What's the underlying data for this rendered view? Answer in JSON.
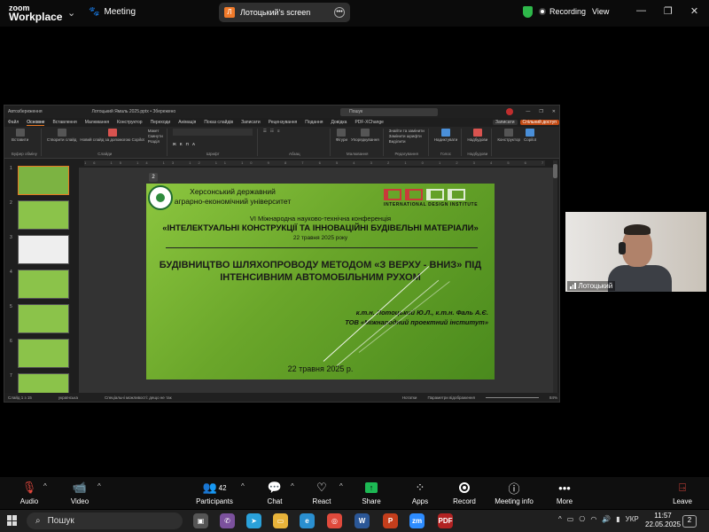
{
  "zoom": {
    "brand_top": "zoom",
    "brand_bottom": "Workplace",
    "meeting_label": "Meeting",
    "share_initial": "Л",
    "share_title": "Лотоцький's screen",
    "recording_label": "Recording",
    "view_label": "View",
    "speaker_name": "Лотоцький",
    "toolbar": {
      "audio": "Audio",
      "video": "Video",
      "participants": "Participants",
      "participants_count": "42",
      "chat": "Chat",
      "react": "React",
      "share": "Share",
      "apps": "Apps",
      "record": "Record",
      "meeting_info": "Meeting info",
      "more": "More",
      "leave": "Leave"
    }
  },
  "ppt": {
    "autosave": "Автозбереження",
    "filename": "Лотоцький Ямаль 2025.pptx • Збережено",
    "search_placeholder": "Пошук",
    "tabs": [
      "Файл",
      "Основне",
      "Вставлення",
      "Малювання",
      "Конструктор",
      "Переходи",
      "Анімація",
      "Показ слайдів",
      "Записати",
      "Рецензування",
      "Подання",
      "Довідка",
      "PDF-XChange"
    ],
    "record_btn": "Записати",
    "share_btn": "Спільний доступ",
    "ribbon_groups": [
      "Буфер обміну",
      "Слайди",
      "Шрифт",
      "Абзац",
      "Малювання",
      "Редагування",
      "Голос",
      "Надбудови"
    ],
    "ribbon_items": {
      "paste": "Вставити",
      "new_slide": "Створити слайд",
      "copilot_slide": "Новий слайд за допомогою Copilot",
      "layout": "Макет",
      "reset": "Скинути",
      "section": "Розділ",
      "shapes": "Фігури",
      "arrange": "Упорядкування",
      "find": "Знайти та замінити",
      "replace_fonts": "Замінити шрифти",
      "select": "Виділити",
      "dictate": "Надиктувати",
      "addins": "Надбудови",
      "designer": "Конструктор",
      "copilot": "Copilot"
    },
    "ruler_marks": "16 15 14 13 12 11 10 9 8 7 6 5 4 3 2 1 0 1 2 3 4 5 6 7 8 9 10 11 12 13 14 15 16",
    "slide_numbers": [
      "1",
      "2",
      "3",
      "4",
      "5",
      "6",
      "7"
    ],
    "status": {
      "slide_of": "Слайд 1 з 15",
      "language": "українська",
      "accessibility": "Спеціальні можливості: дещо не так",
      "notes": "Нотатки",
      "display_settings": "Параметри відображення",
      "zoom": "84%"
    }
  },
  "slide": {
    "badge": "2",
    "university_line1": "Херсонський державний",
    "university_line2": "аграрно-економічний університет",
    "idi_text": "INTERNATIONAL DESIGN INSTITUTE",
    "conference_line": "VI Міжнародна науково-технічна конференція",
    "conference_title": "«ІНТЕЛЕКТУАЛЬНІ КОНСТРУКЦІЇ ТА ІННОВАЦІЙНІ БУДІВЕЛЬНІ МАТЕРІАЛИ»",
    "conference_date": "22 травня 2025 року",
    "talk_line1": "БУДІВНИЦТВО ШЛЯХОПРОВОДУ МЕТОДОМ «З ВЕРХУ - ВНИЗ» ПІД",
    "talk_line2": "ІНТЕНСИВНИМ АВТОМОБІЛЬНИМ РУХОМ",
    "authors_line1": "к.т.н. Лотоцький Ю.Л., к.т.н. Фаль А.Є.",
    "authors_line2": "ТОВ «Міжнародний проектний інститут»",
    "footer_date": "22 травня 2025 р."
  },
  "taskbar": {
    "search_placeholder": "Пошук",
    "language": "УКР",
    "time": "11:57",
    "date": "22.05.2025",
    "notifications": "2"
  }
}
